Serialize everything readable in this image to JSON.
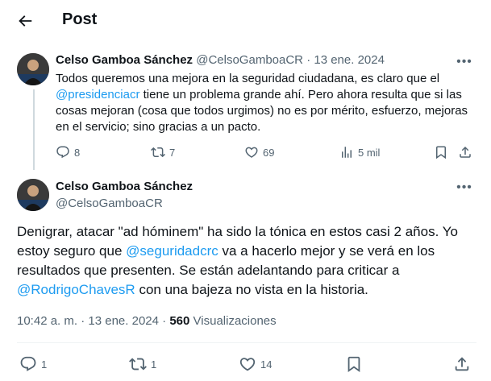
{
  "header": {
    "title": "Post"
  },
  "parent_tweet": {
    "name": "Celso Gamboa Sánchez",
    "handle": "@CelsoGamboaCR",
    "separator": "·",
    "date": "13 ene. 2024",
    "text_1": "Todos queremos una mejora en la seguridad ciudadana, es claro que el ",
    "mention": "@presidenciacr",
    "text_2": " tiene un problema grande ahí. Pero ahora resulta que si las cosas mejoran (cosa que todos urgimos) no es por mérito, esfuerzo, mejoras en el servicio; sino gracias a un pacto.",
    "replies": "8",
    "reposts": "7",
    "likes": "69",
    "views": "5 mil"
  },
  "main_tweet": {
    "name": "Celso Gamboa Sánchez",
    "handle": "@CelsoGamboaCR",
    "text_1": "Denigrar, atacar \"ad hóminem\" ha sido la tónica en estos casi 2 años. Yo estoy seguro que ",
    "mention_1": "@seguridadcrc",
    "text_2": " va a hacerlo mejor y se verá en los resultados que presenten. Se están adelantando para criticar a ",
    "mention_2": "@RodrigoChavesR",
    "text_3": " con una bajeza no vista en la historia.",
    "time": "10:42 a. m.",
    "separator": "·",
    "date": "13 ene. 2024",
    "separator_2": "·",
    "views_count": "560",
    "views_label": "Visualizaciones",
    "replies": "1",
    "reposts": "1",
    "likes": "14"
  },
  "icons": {
    "back": "arrow-left-icon",
    "more": "more-horizontal-icon",
    "reply": "reply-icon",
    "repost": "repost-icon",
    "like": "heart-icon",
    "views": "analytics-icon",
    "bookmark": "bookmark-icon",
    "share": "share-icon"
  }
}
